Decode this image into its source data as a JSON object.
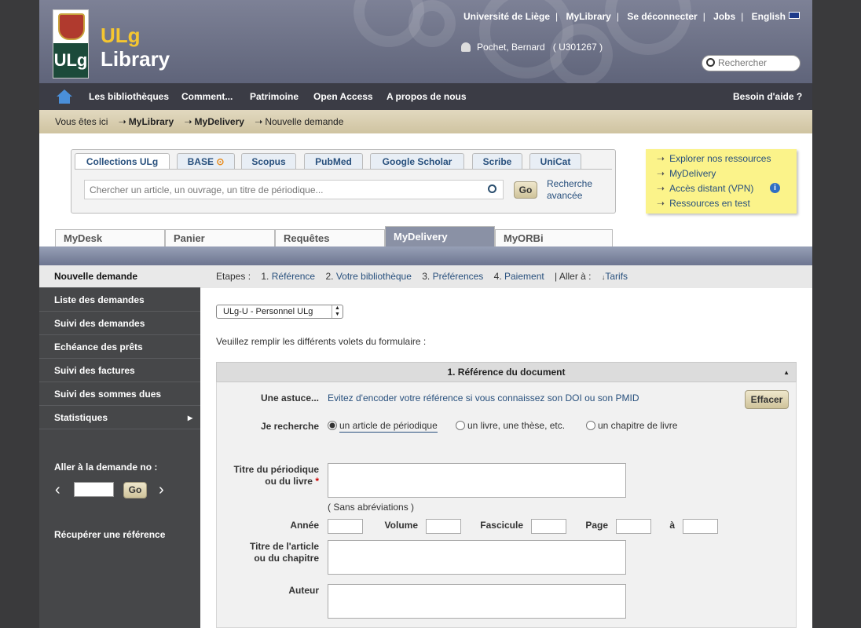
{
  "header": {
    "logo_line1": "ULg",
    "logo_line2": "Library",
    "top_links": [
      "Université de Liège",
      "MyLibrary",
      "Se déconnecter",
      "Jobs",
      "English"
    ],
    "user_name": "Pochet, Bernard",
    "user_id": "( U301267 )",
    "search_placeholder": "Rechercher"
  },
  "nav": {
    "items": [
      "Les bibliothèques",
      "Comment...",
      "Patrimoine",
      "Open Access",
      "A propos de nous"
    ],
    "help": "Besoin d'aide ?"
  },
  "breadcrumb": {
    "prefix": "Vous êtes ici",
    "items": [
      "MyLibrary",
      "MyDelivery",
      "Nouvelle demande"
    ]
  },
  "search_box": {
    "tabs": [
      "Collections ULg",
      "BASE",
      "Scopus",
      "PubMed",
      "Google Scholar",
      "Scribe",
      "UniCat"
    ],
    "placeholder": "Chercher un article, un ouvrage, un titre de périodique...",
    "go": "Go",
    "advanced_line1": "Recherche",
    "advanced_line2": "avancée"
  },
  "note": {
    "items": [
      "Explorer nos ressources",
      "MyDelivery",
      "Accès distant (VPN)",
      "Ressources en test"
    ]
  },
  "page_tabs": [
    "MyDesk",
    "Panier",
    "Requêtes",
    "MyDelivery",
    "MyORBi"
  ],
  "sidebar": {
    "items": [
      "Nouvelle demande",
      "Liste des demandes",
      "Suivi des demandes",
      "Echéance des prêts",
      "Suivi des factures",
      "Suivi des sommes dues",
      "Statistiques"
    ],
    "goto_label": "Aller à la demande no :",
    "go": "Go",
    "retrieve": "Récupérer une référence"
  },
  "steps": {
    "label": "Etapes :",
    "nums": [
      "1.",
      "2.",
      "3.",
      "4."
    ],
    "links": [
      "Référence",
      "Votre bibliothèque",
      "Préférences",
      "Paiement"
    ],
    "goto": "| Aller à :",
    "tarifs": "Tarifs"
  },
  "form": {
    "select_value": "ULg-U - Personnel ULg",
    "intro": "Veuillez remplir les différents volets du formulaire :",
    "section_title": "1. Référence du document",
    "tip_label": "Une astuce...",
    "tip_text": "Evitez d'encoder votre référence si vous connaissez son DOI ou son PMID",
    "clear": "Effacer",
    "search_label": "Je recherche",
    "radios": [
      "un article de périodique",
      "un livre, une thèse, etc.",
      "un chapitre de livre"
    ],
    "journal_label_1": "Titre du périodique",
    "journal_label_2": "ou du livre",
    "required_mark": "*",
    "no_abbrev": "( Sans abréviations )",
    "year": "Année",
    "volume": "Volume",
    "issue": "Fascicule",
    "page": "Page",
    "to": "à",
    "article_label_1": "Titre de l'article",
    "article_label_2": "ou du chapitre",
    "author": "Auteur"
  }
}
